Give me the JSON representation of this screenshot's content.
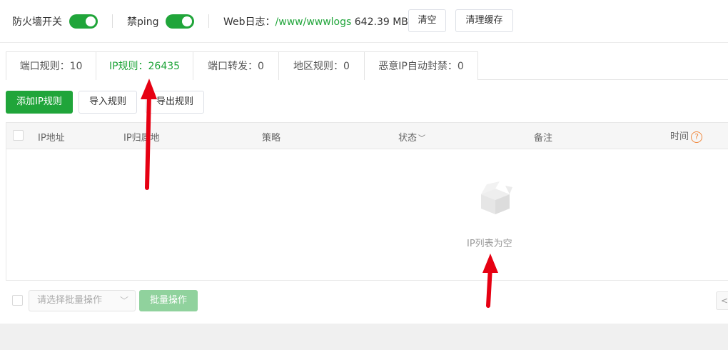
{
  "toolbar": {
    "firewall_label": "防火墙开关",
    "firewall_on": true,
    "ping_label": "禁ping",
    "ping_on": true,
    "weblog_label": "Web日志：",
    "weblog_path": "/www/wwwlogs",
    "weblog_size": "642.39 MB",
    "clear_label": "清空",
    "clean_cache_label": "清理缓存"
  },
  "tabs": [
    {
      "label": "端口规则：10",
      "active": false
    },
    {
      "label": "IP规则：26435",
      "active": true
    },
    {
      "label": "端口转发：0",
      "active": false
    },
    {
      "label": "地区规则：0",
      "active": false
    },
    {
      "label": "恶意IP自动封禁：0",
      "active": false
    }
  ],
  "actions": {
    "add_label": "添加IP规则",
    "import_label": "导入规则",
    "export_label": "导出规则"
  },
  "table": {
    "columns": [
      "IP地址",
      "IP归属地",
      "策略",
      "状态",
      "备注",
      "时间"
    ],
    "help_glyph": "?",
    "empty_text": "IP列表为空"
  },
  "footer": {
    "batch_placeholder": "请选择批量操作",
    "batch_button": "批量操作",
    "pager_prev": "<"
  },
  "colors": {
    "accent": "#20a53a",
    "annotation_arrow": "#e60012"
  }
}
